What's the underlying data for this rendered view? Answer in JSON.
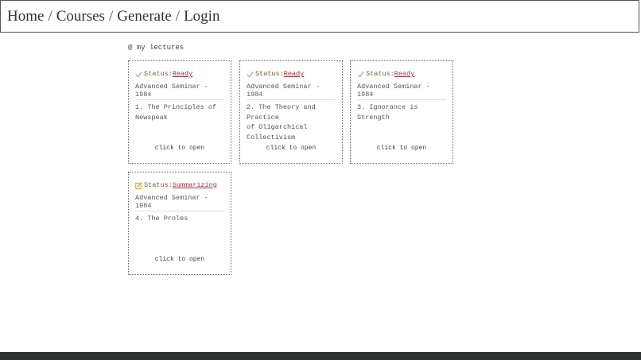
{
  "nav": {
    "items": [
      "Home",
      "Courses",
      "Generate",
      "Login"
    ],
    "separator": "/"
  },
  "section_title": "@ my lectures",
  "colors": {
    "ready_icon": "#7cc47a",
    "summarizing_icon": "#e6a323",
    "status_link": "#a0303a",
    "footer": "#2f3130"
  },
  "lectures": [
    {
      "status_prefix": "Status:",
      "status": "Ready",
      "icon": "check-icon",
      "course": "Advanced Seminar - 1984",
      "title": "1. The Principles of\nNewspeak",
      "open_hint": "click to open"
    },
    {
      "status_prefix": "Status:",
      "status": "Ready",
      "icon": "check-icon",
      "course": "Advanced Seminar - 1984",
      "title": "2. The Theory and Practice\nof Oligarchical\nCollectivism",
      "open_hint": "click to open"
    },
    {
      "status_prefix": "Status:",
      "status": "Ready",
      "icon": "check-icon",
      "course": "Advanced Seminar - 1984",
      "title": "3. Ignorance is Strength",
      "open_hint": "click to open"
    },
    {
      "status_prefix": "Status:",
      "status": "Summarizing",
      "icon": "edit-icon",
      "course": "Advanced Seminar - 1984",
      "title": "4. The Proles",
      "open_hint": "click to open"
    }
  ]
}
